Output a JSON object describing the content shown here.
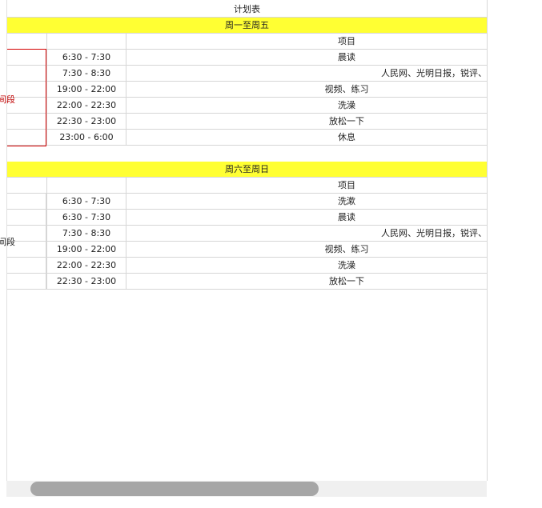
{
  "sheet": {
    "title": "计划表",
    "weekday": {
      "header": "周一至周五",
      "column_item": "项目",
      "period_label": "间段",
      "rows": [
        {
          "time": "6:30 - 7:30",
          "item": "晨读",
          "align": "center"
        },
        {
          "time": "7:30 - 8:30",
          "item": "人民网、光明日报，锐评、",
          "align": "right"
        },
        {
          "time": "19:00 - 22:00",
          "item": "视频、练习",
          "align": "center"
        },
        {
          "time": "22:00 - 22:30",
          "item": "洗澡",
          "align": "center"
        },
        {
          "time": "22:30 - 23:00",
          "item": "放松一下",
          "align": "center"
        },
        {
          "time": "23:00 - 6:00",
          "item": "休息",
          "align": "center"
        }
      ]
    },
    "weekend": {
      "header": "周六至周日",
      "column_item": "项目",
      "period_label": "间段",
      "rows": [
        {
          "time": "6:30 - 7:30",
          "item": "洗漱",
          "align": "center"
        },
        {
          "time": "6:30 - 7:30",
          "item": "晨读",
          "align": "center"
        },
        {
          "time": "7:30 - 8:30",
          "item": "人民网、光明日报，锐评、",
          "align": "right"
        },
        {
          "time": "19:00 - 22:00",
          "item": "视频、练习",
          "align": "center"
        },
        {
          "time": "22:00 - 22:30",
          "item": "洗澡",
          "align": "center"
        },
        {
          "time": "22:30 - 23:00",
          "item": "放松一下",
          "align": "center"
        }
      ]
    }
  },
  "colors": {
    "header_fill": "#ffff33",
    "selection_border": "#d40000",
    "gridline": "#d6d6d6"
  }
}
